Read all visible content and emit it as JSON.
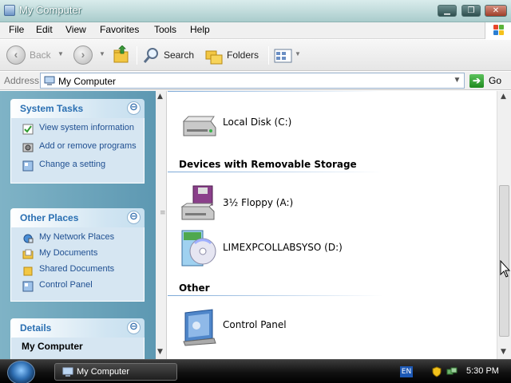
{
  "window": {
    "title": "My Computer",
    "controls": {
      "minimize": "▁",
      "maximize": "❐",
      "close": "✕"
    }
  },
  "menu": {
    "items": [
      "File",
      "Edit",
      "View",
      "Favorites",
      "Tools",
      "Help"
    ]
  },
  "toolbar": {
    "back_label": "Back",
    "search_label": "Search",
    "folders_label": "Folders"
  },
  "address": {
    "label": "Address",
    "value": "My Computer",
    "go_label": "Go"
  },
  "taskpane": {
    "system_tasks": {
      "title": "System Tasks",
      "items": [
        "View system information",
        "Add or remove programs",
        "Change a setting"
      ]
    },
    "other_places": {
      "title": "Other Places",
      "items": [
        "My Network Places",
        "My Documents",
        "Shared Documents",
        "Control Panel"
      ]
    },
    "details": {
      "title": "Details",
      "name": "My Computer"
    }
  },
  "content": {
    "items_top": {
      "label": "Local Disk (C:)"
    },
    "removable": {
      "title": "Devices with Removable Storage",
      "items": [
        "3½ Floppy (A:)",
        "LIMEXPCOLLABSYSO (D:)"
      ]
    },
    "other": {
      "title": "Other",
      "items": [
        "Control Panel"
      ]
    }
  },
  "taskbar": {
    "task_label": "My Computer",
    "language": "EN",
    "clock": "5:30 PM"
  },
  "colors": {
    "titlebar": "#b8d6d6",
    "taskpane_bg": "#6fa8bf",
    "panel_title": "#2a6fb2",
    "link": "#1f4f91"
  }
}
